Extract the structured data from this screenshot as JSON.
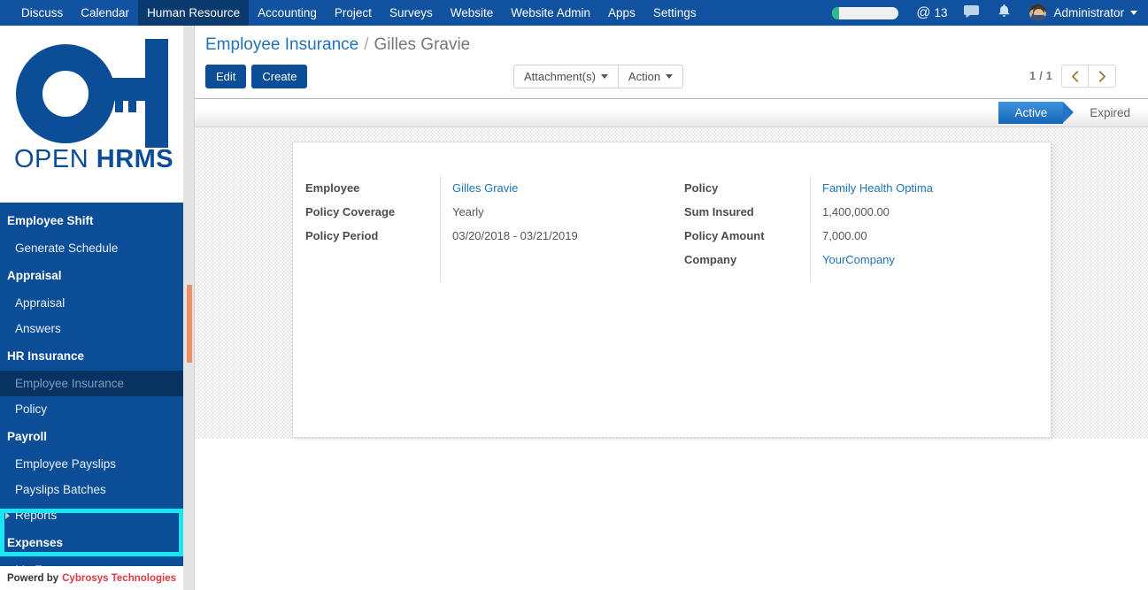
{
  "navbar": {
    "menu_items": [
      {
        "label": "Discuss",
        "active": false
      },
      {
        "label": "Calendar",
        "active": false
      },
      {
        "label": "Human Resource",
        "active": true
      },
      {
        "label": "Accounting",
        "active": false
      },
      {
        "label": "Project",
        "active": false
      },
      {
        "label": "Surveys",
        "active": false
      },
      {
        "label": "Website",
        "active": false
      },
      {
        "label": "Website Admin",
        "active": false
      },
      {
        "label": "Apps",
        "active": false
      },
      {
        "label": "Settings",
        "active": false
      }
    ],
    "mention_symbol": "@",
    "mention_count": "13",
    "chat_icon": "chat-bubble-icon",
    "bell_icon": "bell-icon",
    "user_name": "Administrator",
    "navbar_color": "#10529f",
    "active_item_color": "#0a3a6e"
  },
  "sidebar": {
    "logo": {
      "text_thin": "OPEN",
      "text_bold": "HRMS",
      "color": "#0b4d96"
    },
    "groups": [
      {
        "title": "Employee Shift",
        "items": [
          {
            "label": "Generate Schedule",
            "has_caret": false,
            "active": false
          }
        ]
      },
      {
        "title": "Appraisal",
        "items": [
          {
            "label": "Appraisal",
            "has_caret": false,
            "active": false
          },
          {
            "label": "Answers",
            "has_caret": false,
            "active": false
          }
        ]
      },
      {
        "title": "HR Insurance",
        "highlighted": true,
        "items": [
          {
            "label": "Employee Insurance",
            "has_caret": false,
            "active": true
          },
          {
            "label": "Policy",
            "has_caret": false,
            "active": false
          }
        ]
      },
      {
        "title": "Payroll",
        "items": [
          {
            "label": "Employee Payslips",
            "has_caret": false,
            "active": false
          },
          {
            "label": "Payslips Batches",
            "has_caret": false,
            "active": false
          },
          {
            "label": "Reports",
            "has_caret": true,
            "active": false
          }
        ]
      },
      {
        "title": "Expenses",
        "items": [
          {
            "label": "My Expenses",
            "has_caret": true,
            "active": false
          }
        ]
      }
    ],
    "highlight_color": "#18e6f0",
    "footer": {
      "prefix": "Powerd by",
      "brand": "Cybrosys Technologies",
      "brand_color": "#e0383e"
    },
    "scrollbar_thumb_color": "#ef8f66"
  },
  "control_panel": {
    "breadcrumb": {
      "root": "Employee Insurance",
      "separator": "/",
      "current": "Gilles Gravie"
    },
    "buttons": {
      "edit": "Edit",
      "create": "Create"
    },
    "button_group": [
      {
        "label": "Attachment(s)",
        "icon": "chevron-down-icon"
      },
      {
        "label": "Action",
        "icon": "chevron-down-icon"
      }
    ],
    "pager": {
      "count": "1 / 1",
      "prev_icon": "chevron-left-icon",
      "next_icon": "chevron-right-icon"
    }
  },
  "statusbar": {
    "stages": [
      {
        "label": "Active",
        "selected": true
      },
      {
        "label": "Expired",
        "selected": false
      }
    ],
    "selected_color": "#1565b8"
  },
  "form": {
    "left_column": [
      {
        "label": "Employee",
        "value": "Gilles Gravie",
        "is_link": true
      },
      {
        "label": "Policy Coverage",
        "value": "Yearly",
        "is_link": false
      },
      {
        "label": "Policy Period",
        "value": "03/20/2018 - 03/21/2019",
        "is_link": false
      }
    ],
    "right_column": [
      {
        "label": "Policy",
        "value": "Family Health Optima",
        "is_link": true
      },
      {
        "label": "Sum Insured",
        "value": "1,400,000.00",
        "is_link": false
      },
      {
        "label": "Policy Amount",
        "value": "7,000.00",
        "is_link": false
      },
      {
        "label": "Company",
        "value": "YourCompany",
        "is_link": true
      }
    ]
  }
}
